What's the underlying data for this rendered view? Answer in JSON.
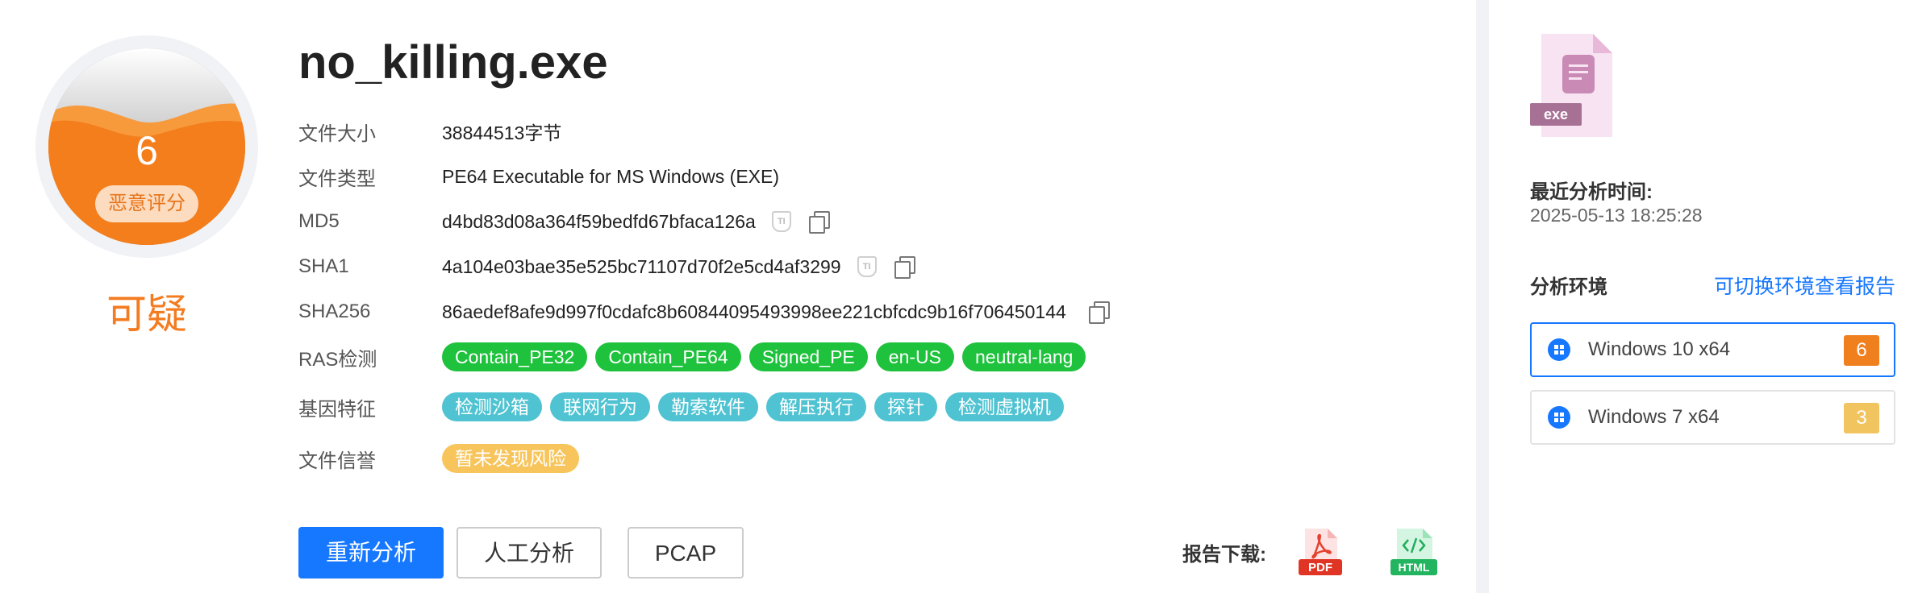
{
  "score": {
    "value": "6",
    "pill_label": "恶意评分",
    "verdict": "可疑",
    "color": "#f47c20"
  },
  "file": {
    "name": "no_killing.exe",
    "rows": {
      "size": {
        "label": "文件大小",
        "value": "38844513字节"
      },
      "type": {
        "label": "文件类型",
        "value": "PE64 Executable for MS Windows (EXE)"
      },
      "md5": {
        "label": "MD5",
        "value": "d4bd83d08a364f59bedfd67bfaca126a"
      },
      "sha1": {
        "label": "SHA1",
        "value": "4a104e03bae35e525bc71107d70f2e5cd4af3299"
      },
      "sha256": {
        "label": "SHA256",
        "value": "86aedef8afe9d997f0cdafc8b60844095493998ee221cbfcdc9b16f706450144"
      },
      "ras": {
        "label": "RAS检测"
      },
      "gene": {
        "label": "基因特征"
      },
      "reputation": {
        "label": "文件信誉"
      }
    },
    "ti_icon_text": "TI",
    "ras_tags": [
      "Contain_PE32",
      "Contain_PE64",
      "Signed_PE",
      "en-US",
      "neutral-lang"
    ],
    "gene_tags": [
      "检测沙箱",
      "联网行为",
      "勒索软件",
      "解压执行",
      "探针",
      "检测虚拟机"
    ],
    "reputation_tag": "暂未发现风险"
  },
  "actions": {
    "reanalyze": "重新分析",
    "manual": "人工分析",
    "pcap": "PCAP",
    "download_label": "报告下载:",
    "pdf_label": "PDF",
    "html_label": "HTML"
  },
  "sidebar": {
    "file_ext": "exe",
    "last_analysis_label": "最近分析时间:",
    "last_analysis_time": "2025-05-13 18:25:28",
    "env_label": "分析环境",
    "switch_link": "可切换环境查看报告",
    "envs": [
      {
        "name": "Windows 10 x64",
        "score": "6",
        "color": "#f07f1e"
      },
      {
        "name": "Windows 7 x64",
        "score": "3",
        "color": "#f2c45f"
      }
    ]
  }
}
